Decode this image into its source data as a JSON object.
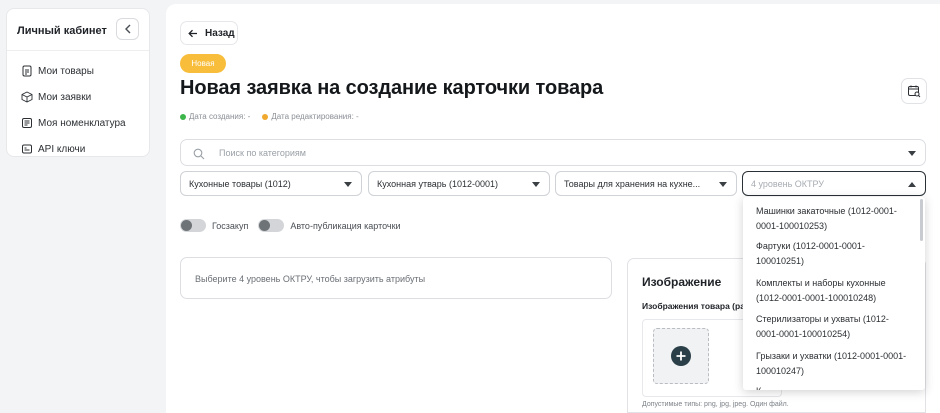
{
  "sidebar": {
    "title": "Личный кабинет",
    "items": [
      {
        "label": "Мои товары",
        "icon": "document-icon"
      },
      {
        "label": "Мои заявки",
        "icon": "box-icon"
      },
      {
        "label": "Моя номенклатура",
        "icon": "list-icon"
      },
      {
        "label": "API ключи",
        "icon": "key-icon"
      }
    ]
  },
  "header": {
    "back_label": "Назад",
    "status_badge": "Новая",
    "title": "Новая заявка на создание карточки товара",
    "created_label": "Дата создания:",
    "created_value": "-",
    "edited_label": "Дата редактирования:",
    "edited_value": "-"
  },
  "search": {
    "placeholder": "Поиск по категориям"
  },
  "selects": [
    {
      "value": "Кухонные товары (1012)"
    },
    {
      "value": "Кухонная утварь (1012-0001)"
    },
    {
      "value": "Товары для хранения на кухне..."
    },
    {
      "placeholder": "4 уровень ОКТРУ"
    }
  ],
  "toggles": {
    "goszakup": "Госзакуп",
    "autopublish": "Авто-публикация карточки"
  },
  "attributes_hint": "Выберите 4 уровень ОКТРУ, чтобы загрузить атрибуты",
  "image_card": {
    "title": "Изображение",
    "subtitle": "Изображения товара (ра",
    "hint": "Допустимые типы: png, jpg, jpeg. Один файл."
  },
  "dropdown": {
    "options": [
      "Машинки закаточные (1012-0001-0001-100010253)",
      "Фартуки (1012-0001-0001-100010251)",
      "Комплекты и наборы кухонные (1012-0001-0001-100010248)",
      "Стерилизаторы и ухваты (1012-0001-0001-100010254)",
      "Грызаки и ухватки (1012-0001-0001-100010247)",
      "К"
    ]
  },
  "colors": {
    "badge": "#f7bd3b",
    "created_dot": "#3cb54a",
    "edited_dot": "#f0a92e",
    "add_button": "#2a3f48"
  }
}
